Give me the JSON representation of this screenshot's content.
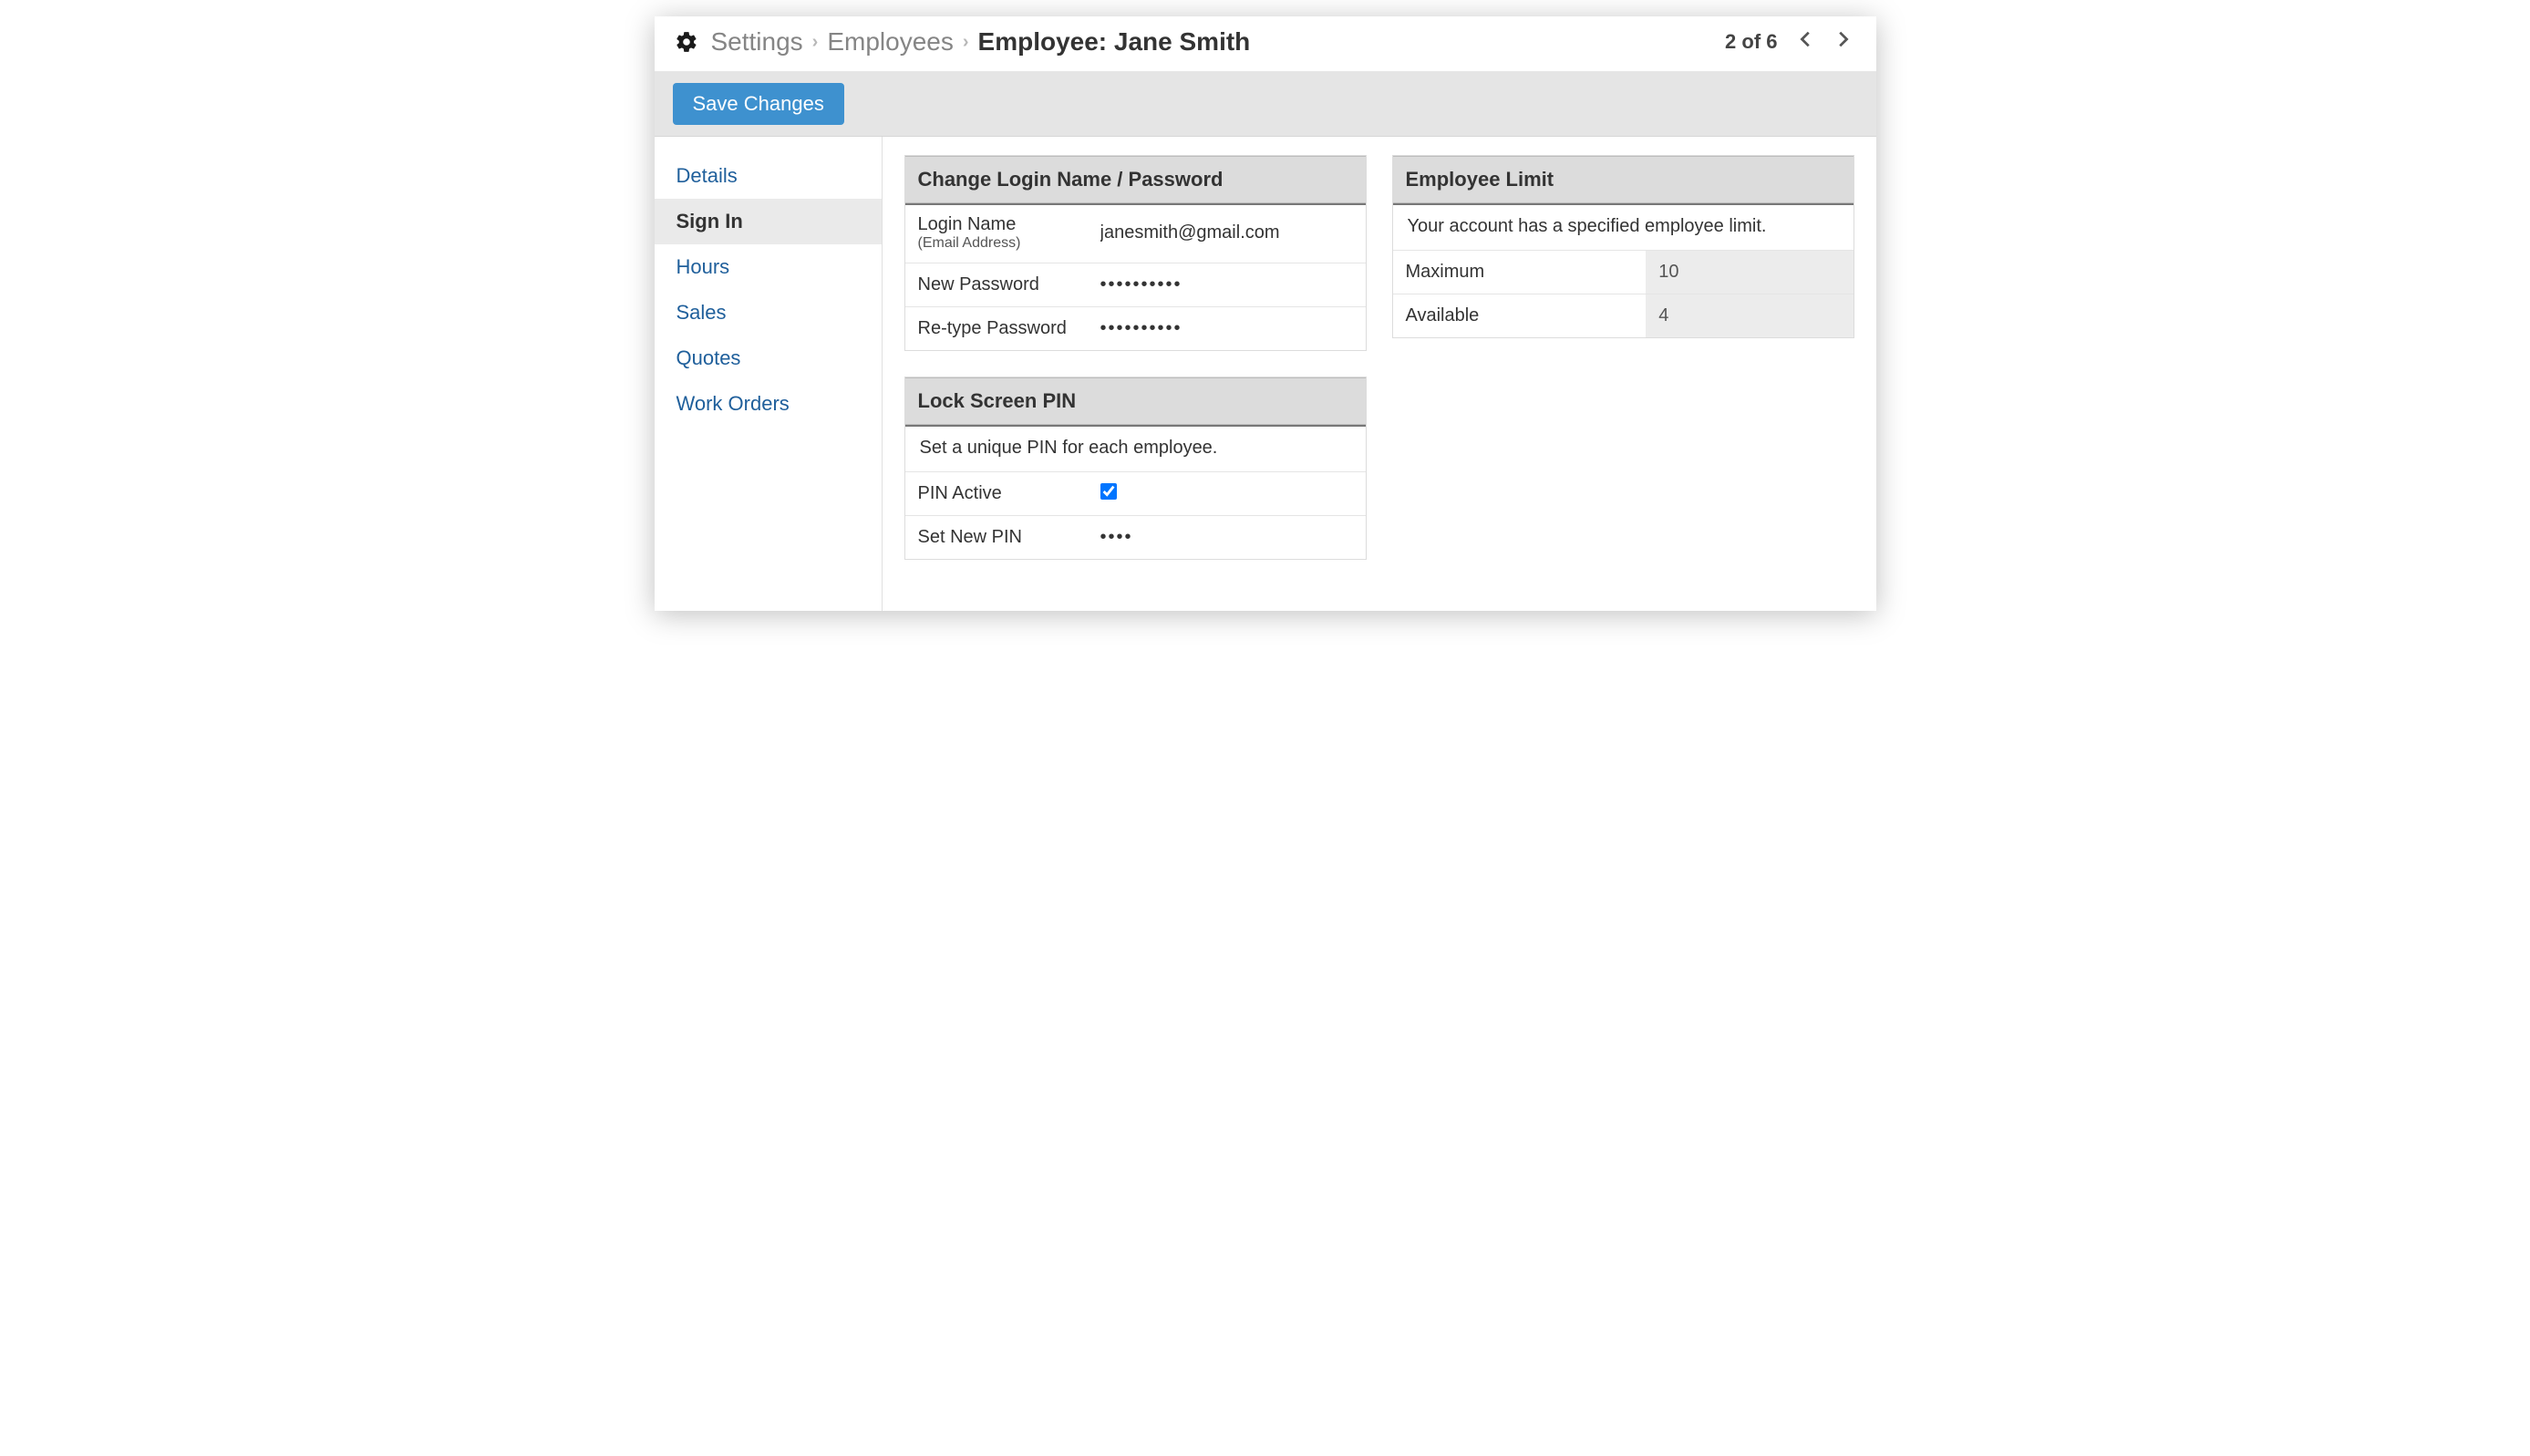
{
  "breadcrumb": {
    "root": "Settings",
    "parent": "Employees",
    "current": "Employee: Jane Smith"
  },
  "pager": {
    "position": "2 of 6"
  },
  "toolbar": {
    "save_label": "Save Changes"
  },
  "sidebar": {
    "items": [
      {
        "label": "Details",
        "active": false
      },
      {
        "label": "Sign In",
        "active": true
      },
      {
        "label": "Hours",
        "active": false
      },
      {
        "label": "Sales",
        "active": false
      },
      {
        "label": "Quotes",
        "active": false
      },
      {
        "label": "Work Orders",
        "active": false
      }
    ]
  },
  "login_panel": {
    "title": "Change Login Name / Password",
    "login_label": "Login Name",
    "login_sublabel": "(Email Address)",
    "login_value": "janesmith@gmail.com",
    "new_password_label": "New Password",
    "new_password_value": "••••••••••",
    "retype_password_label": "Re-type Password",
    "retype_password_value": "••••••••••"
  },
  "pin_panel": {
    "title": "Lock Screen PIN",
    "info": "Set a unique PIN for each employee.",
    "active_label": "PIN Active",
    "active_checked": true,
    "set_pin_label": "Set New PIN",
    "set_pin_value": "••••"
  },
  "limit_panel": {
    "title": "Employee Limit",
    "info": "Your account has a specified employee limit.",
    "maximum_label": "Maximum",
    "maximum_value": "10",
    "available_label": "Available",
    "available_value": "4"
  }
}
